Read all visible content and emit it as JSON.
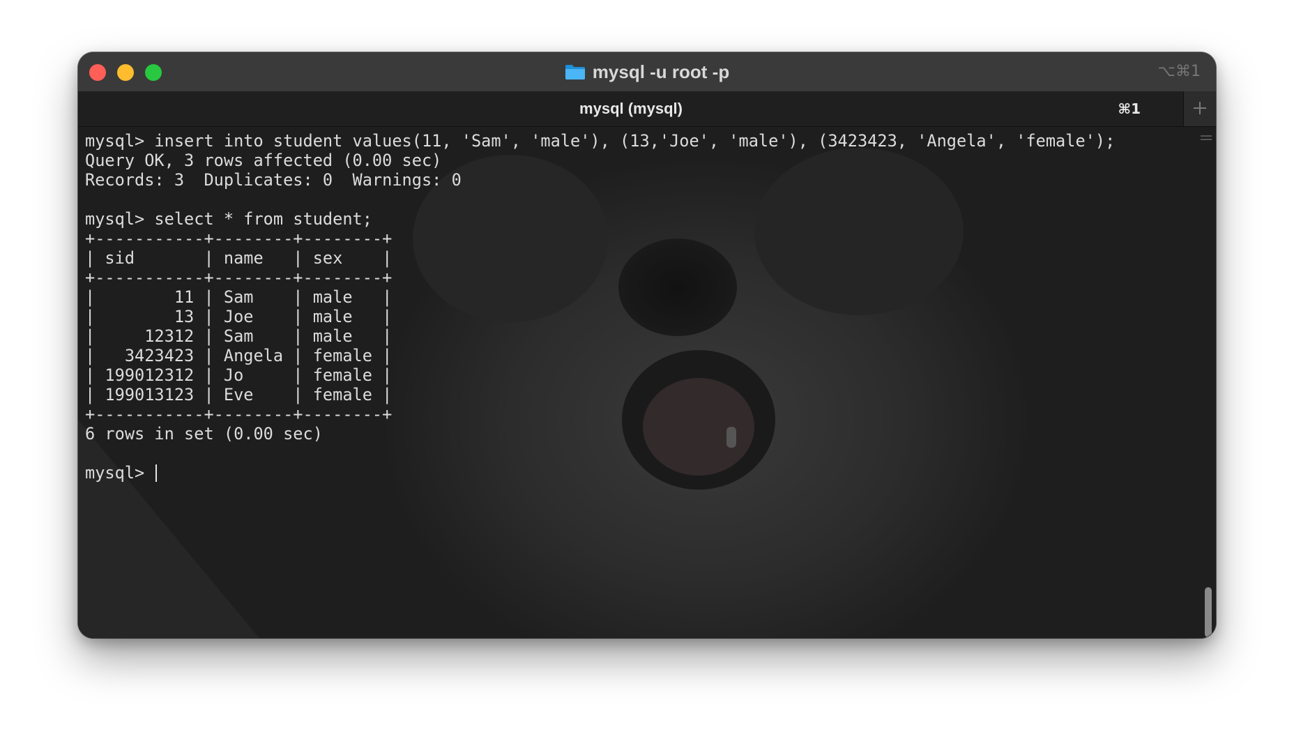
{
  "window": {
    "title": "mysql -u root -p",
    "title_shortcut": "⌥⌘1"
  },
  "tabs": [
    {
      "label": "mysql (mysql)",
      "shortcut": "⌘1",
      "active": true
    }
  ],
  "new_tab_icon": "plus-icon",
  "terminal": {
    "lines": [
      "mysql> insert into student values(11, 'Sam', 'male'), (13,'Joe', 'male'), (3423423, 'Angela', 'female');",
      "Query OK, 3 rows affected (0.00 sec)",
      "Records: 3  Duplicates: 0  Warnings: 0",
      "",
      "mysql> select * from student;",
      "+-----------+--------+--------+",
      "| sid       | name   | sex    |",
      "+-----------+--------+--------+",
      "|        11 | Sam    | male   |",
      "|        13 | Joe    | male   |",
      "|     12312 | Sam    | male   |",
      "|   3423423 | Angela | female |",
      "| 199012312 | Jo     | female |",
      "| 199013123 | Eve    | female |",
      "+-----------+--------+--------+",
      "6 rows in set (0.00 sec)",
      ""
    ],
    "prompt": "mysql> "
  },
  "colors": {
    "close": "#ff5f57",
    "minimize": "#febc2e",
    "zoom": "#28c840",
    "terminal_text": "#dcdcdc",
    "folder": "#35a7f0"
  }
}
